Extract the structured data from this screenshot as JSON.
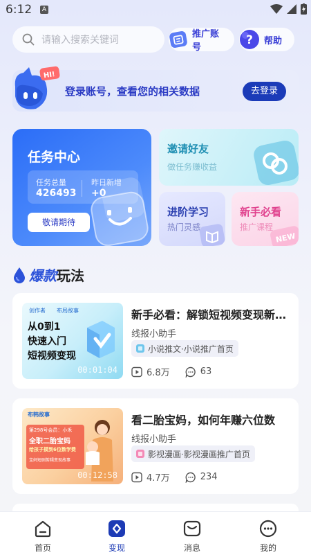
{
  "status_bar": {
    "time": "6:12",
    "badge": "A"
  },
  "search": {
    "placeholder": "请输入搜索关键词"
  },
  "header_buttons": {
    "promo_account": "推广账号",
    "help": "帮助"
  },
  "login_banner": {
    "badge": "HI!",
    "message": "登录账号，查看您的相关数据",
    "button": "去登录"
  },
  "task_center": {
    "title": "任务中心",
    "total_label": "任务总量",
    "total_value": "426493",
    "yesterday_label": "昨日新增",
    "yesterday_value": "+0",
    "button": "敬请期待"
  },
  "invite": {
    "title": "邀请好友",
    "subtitle": "做任务赚收益"
  },
  "learn": {
    "title": "进阶学习",
    "subtitle": "热门灵感"
  },
  "newbie": {
    "title": "新手必看",
    "subtitle": "推广课程",
    "badge": "NEW"
  },
  "section": {
    "title_highlight": "爆款",
    "title_rest": "玩法"
  },
  "videos": [
    {
      "thumb_brand_left": "创作者",
      "thumb_brand_right": "布局故事",
      "thumb_line1": "从0到1",
      "thumb_line2": "快速入门",
      "thumb_line3": "短视频变现",
      "duration": "00:01:04",
      "title": "新手必看：解锁短视频变现新玩法",
      "author": "线报小助手",
      "tag": "小说推文·小说推广首页",
      "plays": "6.8万",
      "comments": "63"
    },
    {
      "thumb_brand": "布韩故事",
      "thumb_line1": "第298号会员：小禾",
      "thumb_line2": "全职二胎宝妈",
      "thumb_line3": "给孩子摸到6位数学费",
      "thumb_line4": "宝妈短剧剪辑变现故事",
      "duration": "00:12:58",
      "title": "看二胎宝妈，如何年赚六位数",
      "author": "线报小助手",
      "tag": "影视漫画·影视漫画推广首页",
      "plays": "4.7万",
      "comments": "234"
    }
  ],
  "nav": [
    {
      "label": "首页",
      "icon": "home-icon"
    },
    {
      "label": "变现",
      "icon": "monetize-icon"
    },
    {
      "label": "消息",
      "icon": "message-icon"
    },
    {
      "label": "我的",
      "icon": "profile-icon"
    }
  ],
  "colors": {
    "accent": "#1d3bb5",
    "primary_blue": "#2b6df7",
    "text": "#222222",
    "muted": "#555555"
  }
}
